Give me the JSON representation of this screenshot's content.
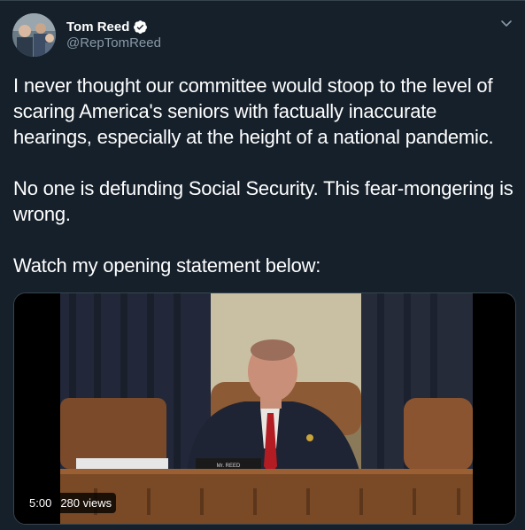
{
  "author": {
    "display_name": "Tom Reed",
    "handle": "@RepTomReed",
    "verified": true
  },
  "tweet": {
    "paragraphs": [
      "I never thought our committee would stoop to the level of scaring America's seniors with factually inaccurate hearings, especially at the height of a national pandemic.",
      "No one is defunding Social Security. This fear-mongering is wrong.",
      "Watch my opening statement below:"
    ]
  },
  "video": {
    "duration": "5:00",
    "views": "280 views",
    "nameplate": "Mr. REED"
  },
  "icons": {
    "verified": "verified-badge-icon",
    "menu": "chevron-down-icon"
  },
  "colors": {
    "background": "#15202b",
    "secondary_text": "#8899a6",
    "border": "#38444d",
    "verified": "#ffffff"
  }
}
